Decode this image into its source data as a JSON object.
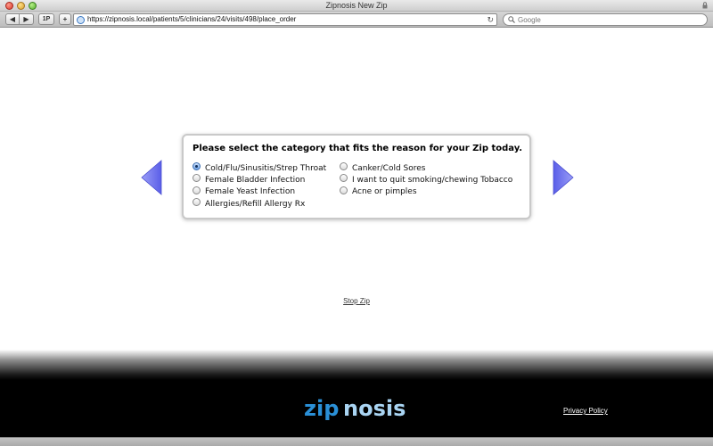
{
  "window": {
    "title": "Zipnosis New Zip"
  },
  "toolbar": {
    "back_label": "◀",
    "forward_label": "▶",
    "onepassword_label": "1P",
    "add_label": "+",
    "url": "https://zipnosis.local/patients/5/clinicians/24/visits/498/place_order",
    "reload_label": "↻",
    "search_placeholder": "Google"
  },
  "main": {
    "prompt": "Please select the category that fits the reason for your Zip today.",
    "options_left": [
      {
        "label": "Cold/Flu/Sinusitis/Strep Throat",
        "checked": true
      },
      {
        "label": "Female Bladder Infection",
        "checked": false
      },
      {
        "label": "Female Yeast Infection",
        "checked": false
      },
      {
        "label": "Allergies/Refill Allergy Rx",
        "checked": false
      }
    ],
    "options_right": [
      {
        "label": "Canker/Cold Sores",
        "checked": false
      },
      {
        "label": "I want to quit smoking/chewing Tobacco",
        "checked": false
      },
      {
        "label": "Acne or pimples",
        "checked": false
      }
    ],
    "stop_link": "Stop Zip"
  },
  "footer": {
    "logo_text_left": "zip",
    "logo_text_right": "nosis",
    "privacy_link": "Privacy Policy"
  },
  "colors": {
    "arrow_purple": "#6b6ff0",
    "logo_blue": "#2a8fd6",
    "logo_light": "#a9d4f2"
  },
  "icons": {
    "window_controls": [
      "close-icon",
      "minimize-icon",
      "maximize-icon"
    ],
    "url_field": "site-globe-icon",
    "search_field": "search-icon",
    "nav": [
      "arrow-left-icon",
      "arrow-right-icon"
    ]
  }
}
